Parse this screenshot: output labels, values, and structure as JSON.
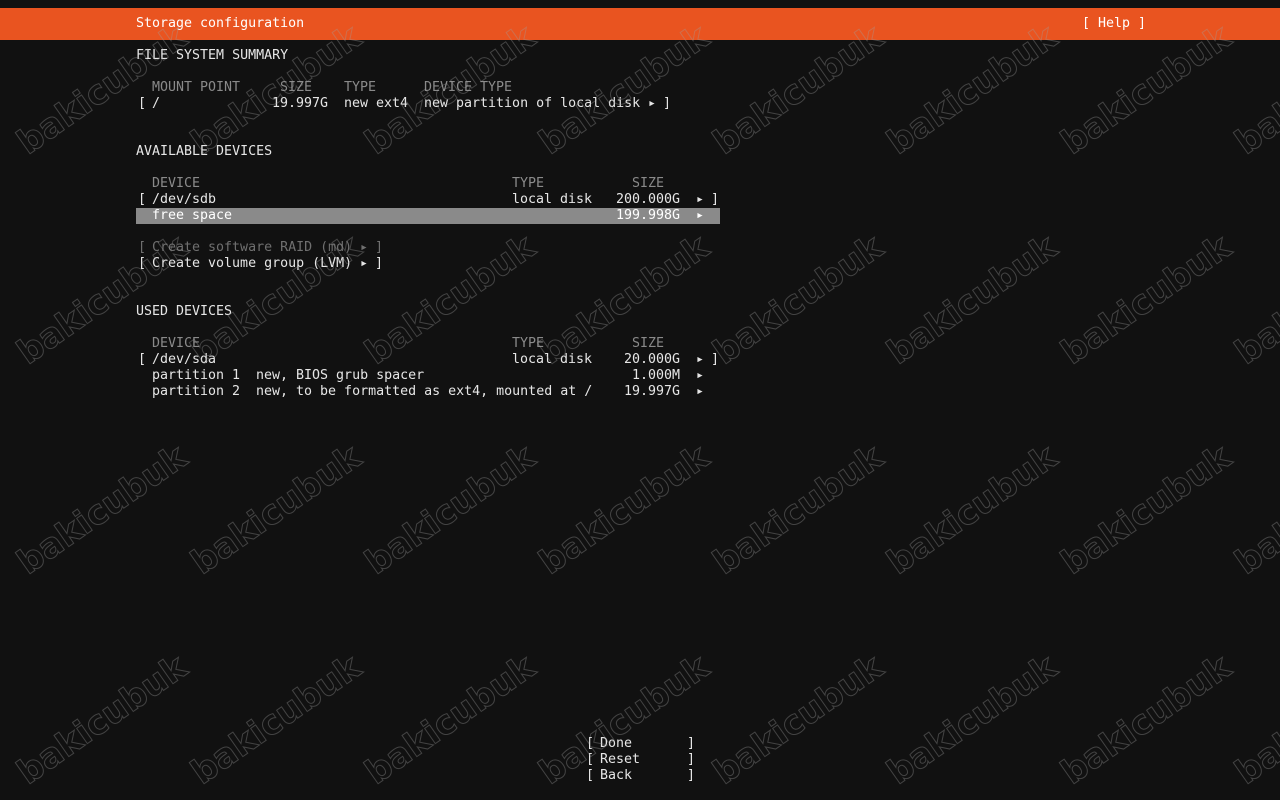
{
  "header": {
    "title": "Storage configuration",
    "help": "[ Help ]"
  },
  "fs_summary": {
    "heading": "FILE SYSTEM SUMMARY",
    "columns": [
      "MOUNT POINT",
      "SIZE",
      "TYPE",
      "DEVICE TYPE"
    ],
    "rows": [
      {
        "bracket_open": "[",
        "mount": "/",
        "size": "19.997G",
        "type": "new ext4",
        "device_type": "new partition of local disk",
        "arrow": "▸",
        "bracket_close": "]"
      }
    ]
  },
  "available": {
    "heading": "AVAILABLE DEVICES",
    "columns": [
      "DEVICE",
      "TYPE",
      "SIZE"
    ],
    "rows": [
      {
        "device": "/dev/sdb",
        "type": "local disk",
        "size": "200.000G",
        "arrow": "▸"
      },
      {
        "device": "free space",
        "type": "",
        "size": "199.998G",
        "arrow": "▸"
      }
    ],
    "actions": [
      {
        "label": "Create software RAID (md)",
        "arrow": "▸"
      },
      {
        "label": "Create volume group (LVM)",
        "arrow": "▸"
      }
    ]
  },
  "used": {
    "heading": "USED DEVICES",
    "columns": [
      "DEVICE",
      "TYPE",
      "SIZE"
    ],
    "rows": [
      {
        "device": "/dev/sda",
        "type": "local disk",
        "size": "20.000G",
        "arrow": "▸"
      },
      {
        "device": "partition 1",
        "type": "new, BIOS grub spacer",
        "size": "1.000M",
        "arrow": "▸"
      },
      {
        "device": "partition 2",
        "type": "new, to be formatted as ext4, mounted at /",
        "size": "19.997G",
        "arrow": "▸"
      }
    ]
  },
  "buttons": [
    {
      "label": "Done"
    },
    {
      "label": "Reset"
    },
    {
      "label": "Back"
    }
  ],
  "bracket_open": "[",
  "bracket_close": "]",
  "watermark": "bakicubuk",
  "colors": {
    "header": "#e95420",
    "background": "#111111",
    "selection": "#8a8a8a"
  }
}
